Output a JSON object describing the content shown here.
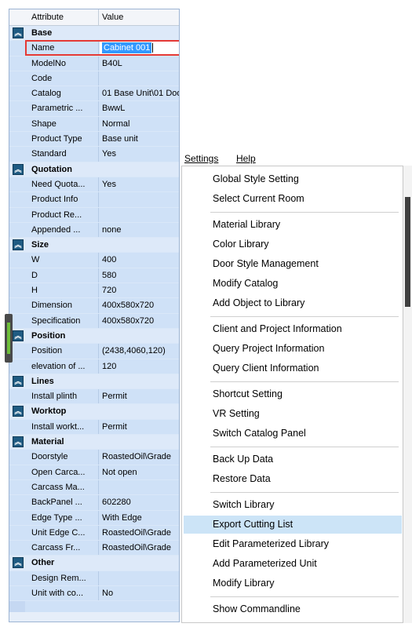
{
  "grid": {
    "header": {
      "attribute": "Attribute",
      "value": "Value"
    },
    "rows": [
      {
        "type": "cat",
        "label": "Base"
      },
      {
        "type": "prop",
        "label": "Name",
        "value": "Cabinet 001",
        "editing": true
      },
      {
        "type": "prop",
        "label": "ModelNo",
        "value": "B40L"
      },
      {
        "type": "prop",
        "label": "Code",
        "value": ""
      },
      {
        "type": "prop",
        "label": "Catalog",
        "value": "01 Base Unit\\01 Doo"
      },
      {
        "type": "prop",
        "label": "Parametric ...",
        "value": "BwwL"
      },
      {
        "type": "prop",
        "label": "Shape",
        "value": "Normal"
      },
      {
        "type": "prop",
        "label": "Product Type",
        "value": "Base unit"
      },
      {
        "type": "prop",
        "label": "Standard",
        "value": "Yes"
      },
      {
        "type": "cat",
        "label": "Quotation"
      },
      {
        "type": "prop",
        "label": "Need Quota...",
        "value": "Yes"
      },
      {
        "type": "prop",
        "label": "Product Info",
        "value": ""
      },
      {
        "type": "prop",
        "label": "Product Re...",
        "value": ""
      },
      {
        "type": "prop",
        "label": "Appended ...",
        "value": "none"
      },
      {
        "type": "cat",
        "label": "Size"
      },
      {
        "type": "prop",
        "label": "W",
        "value": "400"
      },
      {
        "type": "prop",
        "label": "D",
        "value": "580"
      },
      {
        "type": "prop",
        "label": "H",
        "value": "720"
      },
      {
        "type": "prop",
        "label": "Dimension",
        "value": "400x580x720"
      },
      {
        "type": "prop",
        "label": "Specification",
        "value": "400x580x720"
      },
      {
        "type": "cat",
        "label": "Position"
      },
      {
        "type": "prop",
        "label": "Position",
        "value": "(2438,4060,120)"
      },
      {
        "type": "prop",
        "label": "elevation of ...",
        "value": "120"
      },
      {
        "type": "cat",
        "label": "Lines"
      },
      {
        "type": "prop",
        "label": "Install plinth",
        "value": "Permit"
      },
      {
        "type": "cat",
        "label": "Worktop"
      },
      {
        "type": "prop",
        "label": "Install workt...",
        "value": "Permit"
      },
      {
        "type": "cat",
        "label": "Material"
      },
      {
        "type": "prop",
        "label": "Doorstyle",
        "value": "RoastedOil\\Grade"
      },
      {
        "type": "prop",
        "label": "Open Carca...",
        "value": "Not open"
      },
      {
        "type": "prop",
        "label": "Carcass Ma...",
        "value": ""
      },
      {
        "type": "prop",
        "label": "BackPanel ...",
        "value": "602280"
      },
      {
        "type": "prop",
        "label": "Edge Type ...",
        "value": "With Edge"
      },
      {
        "type": "prop",
        "label": "Unit Edge C...",
        "value": "RoastedOil\\Grade"
      },
      {
        "type": "prop",
        "label": "Carcass Fr...",
        "value": "RoastedOil\\Grade"
      },
      {
        "type": "cat",
        "label": "Other"
      },
      {
        "type": "prop",
        "label": "Design Rem...",
        "value": ""
      },
      {
        "type": "prop",
        "label": "Unit with co...",
        "value": "No"
      }
    ],
    "collapse_icon": "double-chevron-up-icon"
  },
  "menubar": {
    "settings": "Settings",
    "help": "Help"
  },
  "menu": {
    "items": [
      {
        "label": "Global Style Setting"
      },
      {
        "label": "Select Current Room"
      },
      {
        "sep": true
      },
      {
        "label": "Material Library"
      },
      {
        "label": "Color Library"
      },
      {
        "label": "Door Style Management"
      },
      {
        "label": "Modify Catalog"
      },
      {
        "label": "Add Object to Library"
      },
      {
        "sep": true
      },
      {
        "label": "Client and Project Information"
      },
      {
        "label": "Query Project Information"
      },
      {
        "label": "Query Client Information"
      },
      {
        "sep": true
      },
      {
        "label": "Shortcut Setting"
      },
      {
        "label": "VR Setting"
      },
      {
        "label": "Switch Catalog Panel"
      },
      {
        "sep": true
      },
      {
        "label": "Back Up Data"
      },
      {
        "label": "Restore Data"
      },
      {
        "sep": true
      },
      {
        "label": "Switch Library"
      },
      {
        "label": "Export Cutting List",
        "highlighted": true
      },
      {
        "label": "Edit Parameterized Library"
      },
      {
        "label": "Add Parameterized Unit"
      },
      {
        "label": "Modify Library"
      },
      {
        "sep": true
      },
      {
        "label": "Show Commandline"
      }
    ]
  },
  "colors": {
    "grid_bg": "#cfe1f7",
    "category_button": "#1f5b82",
    "edit_border": "#e53935",
    "menu_highlight": "#cce4f7"
  }
}
